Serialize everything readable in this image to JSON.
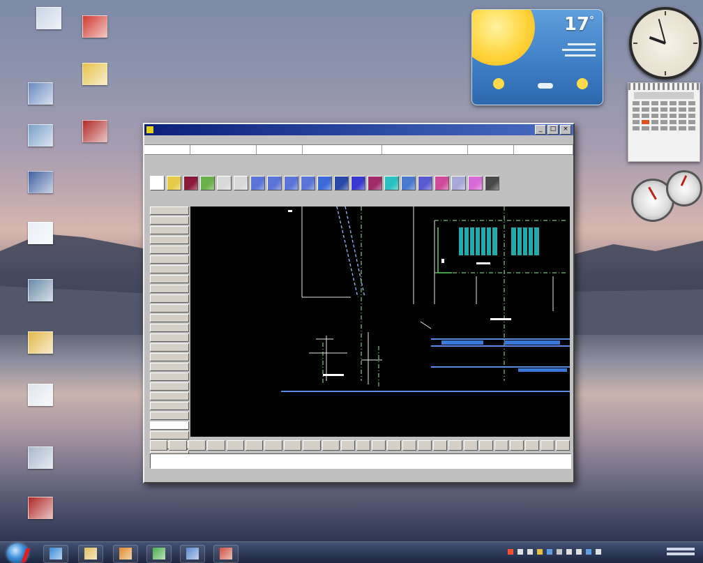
{
  "desktop": {
    "icons": [
      {
        "name": "recycle-bin",
        "label": "",
        "color": "#c8d4e6"
      },
      {
        "name": "desktop-shortcut-2",
        "label": "",
        "color": "#cf3a30"
      },
      {
        "name": "desktop-shortcut-3",
        "label": "",
        "color": "#6a8ac0"
      },
      {
        "name": "desktop-folder",
        "label": "",
        "color": "#e6c24a"
      },
      {
        "name": "desktop-shortcut-5",
        "label": "",
        "color": "#7aa0c8"
      },
      {
        "name": "desktop-shortcut-6",
        "label": "",
        "color": "#b02a28"
      },
      {
        "name": "desktop-shortcut-7",
        "label": "",
        "color": "#4060a0"
      },
      {
        "name": "desktop-document",
        "label": "",
        "color": "#e8eef6"
      },
      {
        "name": "desktop-shortcut-9",
        "label": "",
        "color": "#6a8aa8"
      },
      {
        "name": "desktop-folder-2",
        "label": "",
        "color": "#e2b84a"
      },
      {
        "name": "desktop-text-file",
        "label": "",
        "color": "#e0e6ee"
      },
      {
        "name": "desktop-shortcut-12",
        "label": "",
        "color": "#a8b8cc"
      },
      {
        "name": "desktop-shortcut-13",
        "label": "",
        "color": "#b02828"
      }
    ]
  },
  "gadgets": {
    "weather": {
      "temperature": "17",
      "unit": "°",
      "sky_color": "#4a8ad0"
    },
    "clock": {
      "hour_angle": 200,
      "minute_angle": 255
    }
  },
  "cad_window": {
    "title": "",
    "menus": [
      "",
      "",
      "",
      "",
      "",
      "",
      "",
      "",
      "",
      ""
    ],
    "info_fields": [
      "",
      "",
      "",
      "",
      "",
      "",
      ""
    ],
    "hint": "",
    "status": "",
    "tool_colors": [
      "#ffffff",
      "#e6c94a",
      "#8a1a3a",
      "#6bb04a",
      "#d8d8d8",
      "#d8d8d8",
      "#5a74d8",
      "#5a74d8",
      "#5a74d8",
      "#5a74d8",
      "#3c6ad8",
      "#2a4aa8",
      "#3a3ad0",
      "#a02a6a",
      "#2ac0c0",
      "#4a7ad0",
      "#5a5ad0",
      "#d04a9a",
      "#a8a8d8",
      "#d86ad8",
      "#4a4a4a"
    ],
    "side_buttons": [
      "",
      "",
      "",
      "",
      "",
      "",
      "",
      "",
      "",
      "",
      "",
      "",
      "",
      "",
      "",
      "",
      "",
      "",
      "",
      "",
      "",
      "",
      "",
      "",
      "",
      "",
      ""
    ],
    "selected_side_index": 22,
    "command_buttons": [
      "",
      "",
      "",
      "",
      "",
      "",
      "",
      "",
      "",
      "",
      "",
      "",
      "",
      "",
      "",
      "",
      "",
      "",
      "",
      "",
      "",
      "",
      "",
      "",
      ""
    ]
  },
  "taskbar": {
    "pinned": [
      {
        "name": "taskbar-ie",
        "color": "#3a8ad8"
      },
      {
        "name": "taskbar-explorer",
        "color": "#e2c060"
      },
      {
        "name": "taskbar-media-player",
        "color": "#e08a2a"
      },
      {
        "name": "taskbar-app-4",
        "color": "#4ab04a"
      },
      {
        "name": "taskbar-app-5",
        "color": "#5a8ad0"
      },
      {
        "name": "taskbar-cad",
        "color": "#d05040"
      }
    ],
    "tray_colors": [
      "#ff5030",
      "#e0e0e0",
      "#e0e0e0",
      "#e6c040",
      "#60a0e0",
      "#c8c8c8",
      "#e0e0e0",
      "#e0e0e0",
      "#60a0e0",
      "#e0e0e0"
    ]
  }
}
